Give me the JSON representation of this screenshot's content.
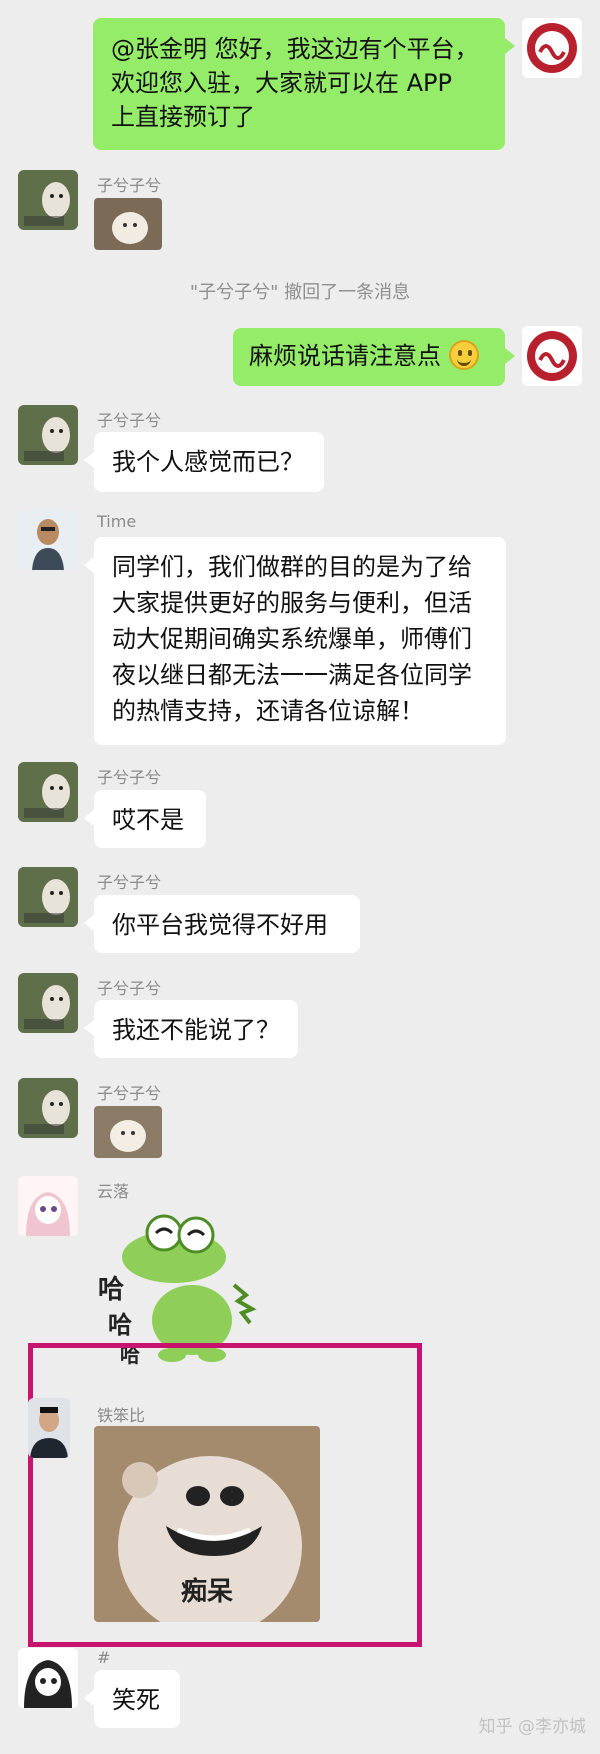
{
  "messages": {
    "m1_text": "@张金明 您好，我这边有个平台，欢迎您入驻，大家就可以在 APP 上直接预订了",
    "m1_line1": "@张金明  您好，我这边有个平台，",
    "m1_line2": "欢迎您入驻，大家就可以在 APP",
    "m1_line3": "上直接预订了",
    "m2_name": "子兮子兮",
    "system_recall": "\"子兮子兮\" 撤回了一条消息",
    "m3_text": "麻烦说话请注意点",
    "m4_name": "子兮子兮",
    "m4_text": "我个人感觉而已？",
    "m5_name": "Time",
    "m5_line1": "同学们，我们做群的目的是为了给",
    "m5_line2": "大家提供更好的服务与便利，但活",
    "m5_line3": "动大促期间确实系统爆单，师傅们",
    "m5_line4": "夜以继日都无法一一满足各位同学",
    "m5_line5": "的热情支持，还请各位谅解！",
    "m6_name": "子兮子兮",
    "m6_text": "哎不是",
    "m7_name": "子兮子兮",
    "m7_text": "你平台我觉得不好用",
    "m8_name": "子兮子兮",
    "m8_text": "我还不能说了？",
    "m9_name": "子兮子兮",
    "m10_name": "云落",
    "m10_sticker_text_1": "哈",
    "m10_sticker_text_2": "哈",
    "m10_sticker_text_3": "哈",
    "m11_name": "铁笨比",
    "m11_sticker_caption": "痴呆",
    "m12_name": "#",
    "m12_text": "笑死"
  },
  "watermark": "知乎 @李亦城",
  "colors": {
    "background": "#ededed",
    "bubble_self": "#95ec69",
    "bubble_other": "#ffffff",
    "highlight_border": "#c8146e"
  },
  "icons": {
    "own_avatar": "red-seal-logo-icon",
    "dog_avatar": "dog-photo-icon",
    "man_avatar": "cartoon-man-icon",
    "anime_avatar": "anime-girl-icon",
    "person_avatar": "man-photo-icon",
    "sketch_avatar": "manga-girl-icon"
  }
}
